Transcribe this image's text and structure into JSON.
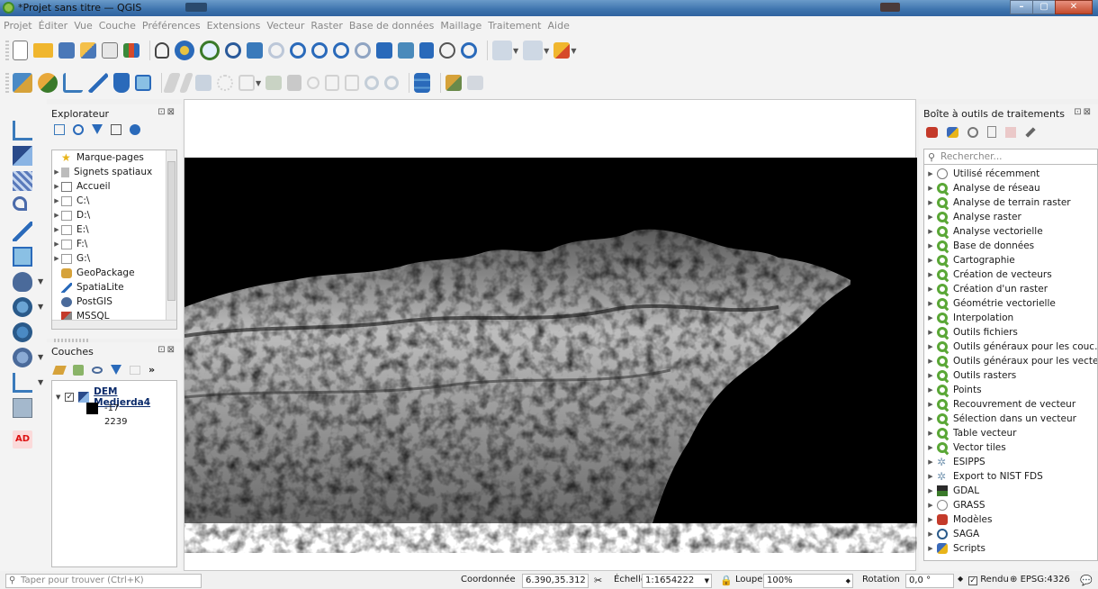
{
  "window": {
    "title": "*Projet sans titre — QGIS",
    "controls": [
      "–",
      "▢",
      "✕"
    ]
  },
  "menubar": [
    "Projet",
    "Éditer",
    "Vue",
    "Couche",
    "Préférences",
    "Extensions",
    "Vecteur",
    "Raster",
    "Base de données",
    "Maillage",
    "Traitement",
    "Aide"
  ],
  "browser": {
    "title": "Explorateur",
    "items": [
      {
        "label": "Marque-pages",
        "icon": "star-icon",
        "expandable": false
      },
      {
        "label": "Signets spatiaux",
        "icon": "bookmark-icon",
        "expandable": true
      },
      {
        "label": "Accueil",
        "icon": "home-folder-icon",
        "expandable": true
      },
      {
        "label": "C:\\",
        "icon": "drive-icon",
        "expandable": true
      },
      {
        "label": "D:\\",
        "icon": "drive-icon",
        "expandable": true
      },
      {
        "label": "E:\\",
        "icon": "drive-icon",
        "expandable": true
      },
      {
        "label": "F:\\",
        "icon": "drive-icon",
        "expandable": true
      },
      {
        "label": "G:\\",
        "icon": "drive-icon",
        "expandable": true
      },
      {
        "label": "GeoPackage",
        "icon": "geopackage-icon",
        "expandable": false
      },
      {
        "label": "SpatiaLite",
        "icon": "spatialite-icon",
        "expandable": false
      },
      {
        "label": "PostGIS",
        "icon": "postgis-icon",
        "expandable": false
      },
      {
        "label": "MSSQL",
        "icon": "mssql-icon",
        "expandable": false
      }
    ]
  },
  "layers": {
    "title": "Couches",
    "layer": {
      "name": "DEM Medjerda4",
      "checked": true,
      "min": "-17",
      "max": "2239"
    }
  },
  "toolbox": {
    "title": "Boîte à outils de traitements",
    "search_placeholder": "Rechercher...",
    "items": [
      {
        "label": "Utilisé récemment",
        "icon": "clock-icon"
      },
      {
        "label": "Analyse de réseau",
        "icon": "qgis-icon"
      },
      {
        "label": "Analyse de terrain raster",
        "icon": "qgis-icon"
      },
      {
        "label": "Analyse raster",
        "icon": "qgis-icon"
      },
      {
        "label": "Analyse vectorielle",
        "icon": "qgis-icon"
      },
      {
        "label": "Base de données",
        "icon": "qgis-icon"
      },
      {
        "label": "Cartographie",
        "icon": "qgis-icon"
      },
      {
        "label": "Création de vecteurs",
        "icon": "qgis-icon"
      },
      {
        "label": "Création d'un raster",
        "icon": "qgis-icon"
      },
      {
        "label": "Géométrie vectorielle",
        "icon": "qgis-icon"
      },
      {
        "label": "Interpolation",
        "icon": "qgis-icon"
      },
      {
        "label": "Outils fichiers",
        "icon": "qgis-icon"
      },
      {
        "label": "Outils généraux pour les couc...",
        "icon": "qgis-icon"
      },
      {
        "label": "Outils généraux pour les vecte...",
        "icon": "qgis-icon"
      },
      {
        "label": "Outils rasters",
        "icon": "qgis-icon"
      },
      {
        "label": "Points",
        "icon": "qgis-icon"
      },
      {
        "label": "Recouvrement de vecteur",
        "icon": "qgis-icon"
      },
      {
        "label": "Sélection dans un vecteur",
        "icon": "qgis-icon"
      },
      {
        "label": "Table vecteur",
        "icon": "qgis-icon"
      },
      {
        "label": "Vector tiles",
        "icon": "qgis-icon"
      },
      {
        "label": "ESIPPS",
        "icon": "plugin-icon"
      },
      {
        "label": "Export to NIST FDS",
        "icon": "plugin-icon"
      },
      {
        "label": "GDAL",
        "icon": "gdal-icon"
      },
      {
        "label": "GRASS",
        "icon": "grass-icon"
      },
      {
        "label": "Modèles",
        "icon": "models-icon"
      },
      {
        "label": "SAGA",
        "icon": "saga-icon"
      },
      {
        "label": "Scripts",
        "icon": "python-icon"
      }
    ]
  },
  "leftbar": {
    "badge": "AD"
  },
  "statusbar": {
    "locator_placeholder": "Taper pour trouver (Ctrl+K)",
    "coord_label": "Coordonnée",
    "coord_value": "6.390,35.312",
    "scale_label": "Échelle",
    "scale_value": "1:1654222",
    "magnifier_label": "Loupe",
    "magnifier_value": "100%",
    "rotation_label": "Rotation",
    "rotation_value": "0,0 °",
    "render_label": "Rendu",
    "crs": "EPSG:4326"
  }
}
